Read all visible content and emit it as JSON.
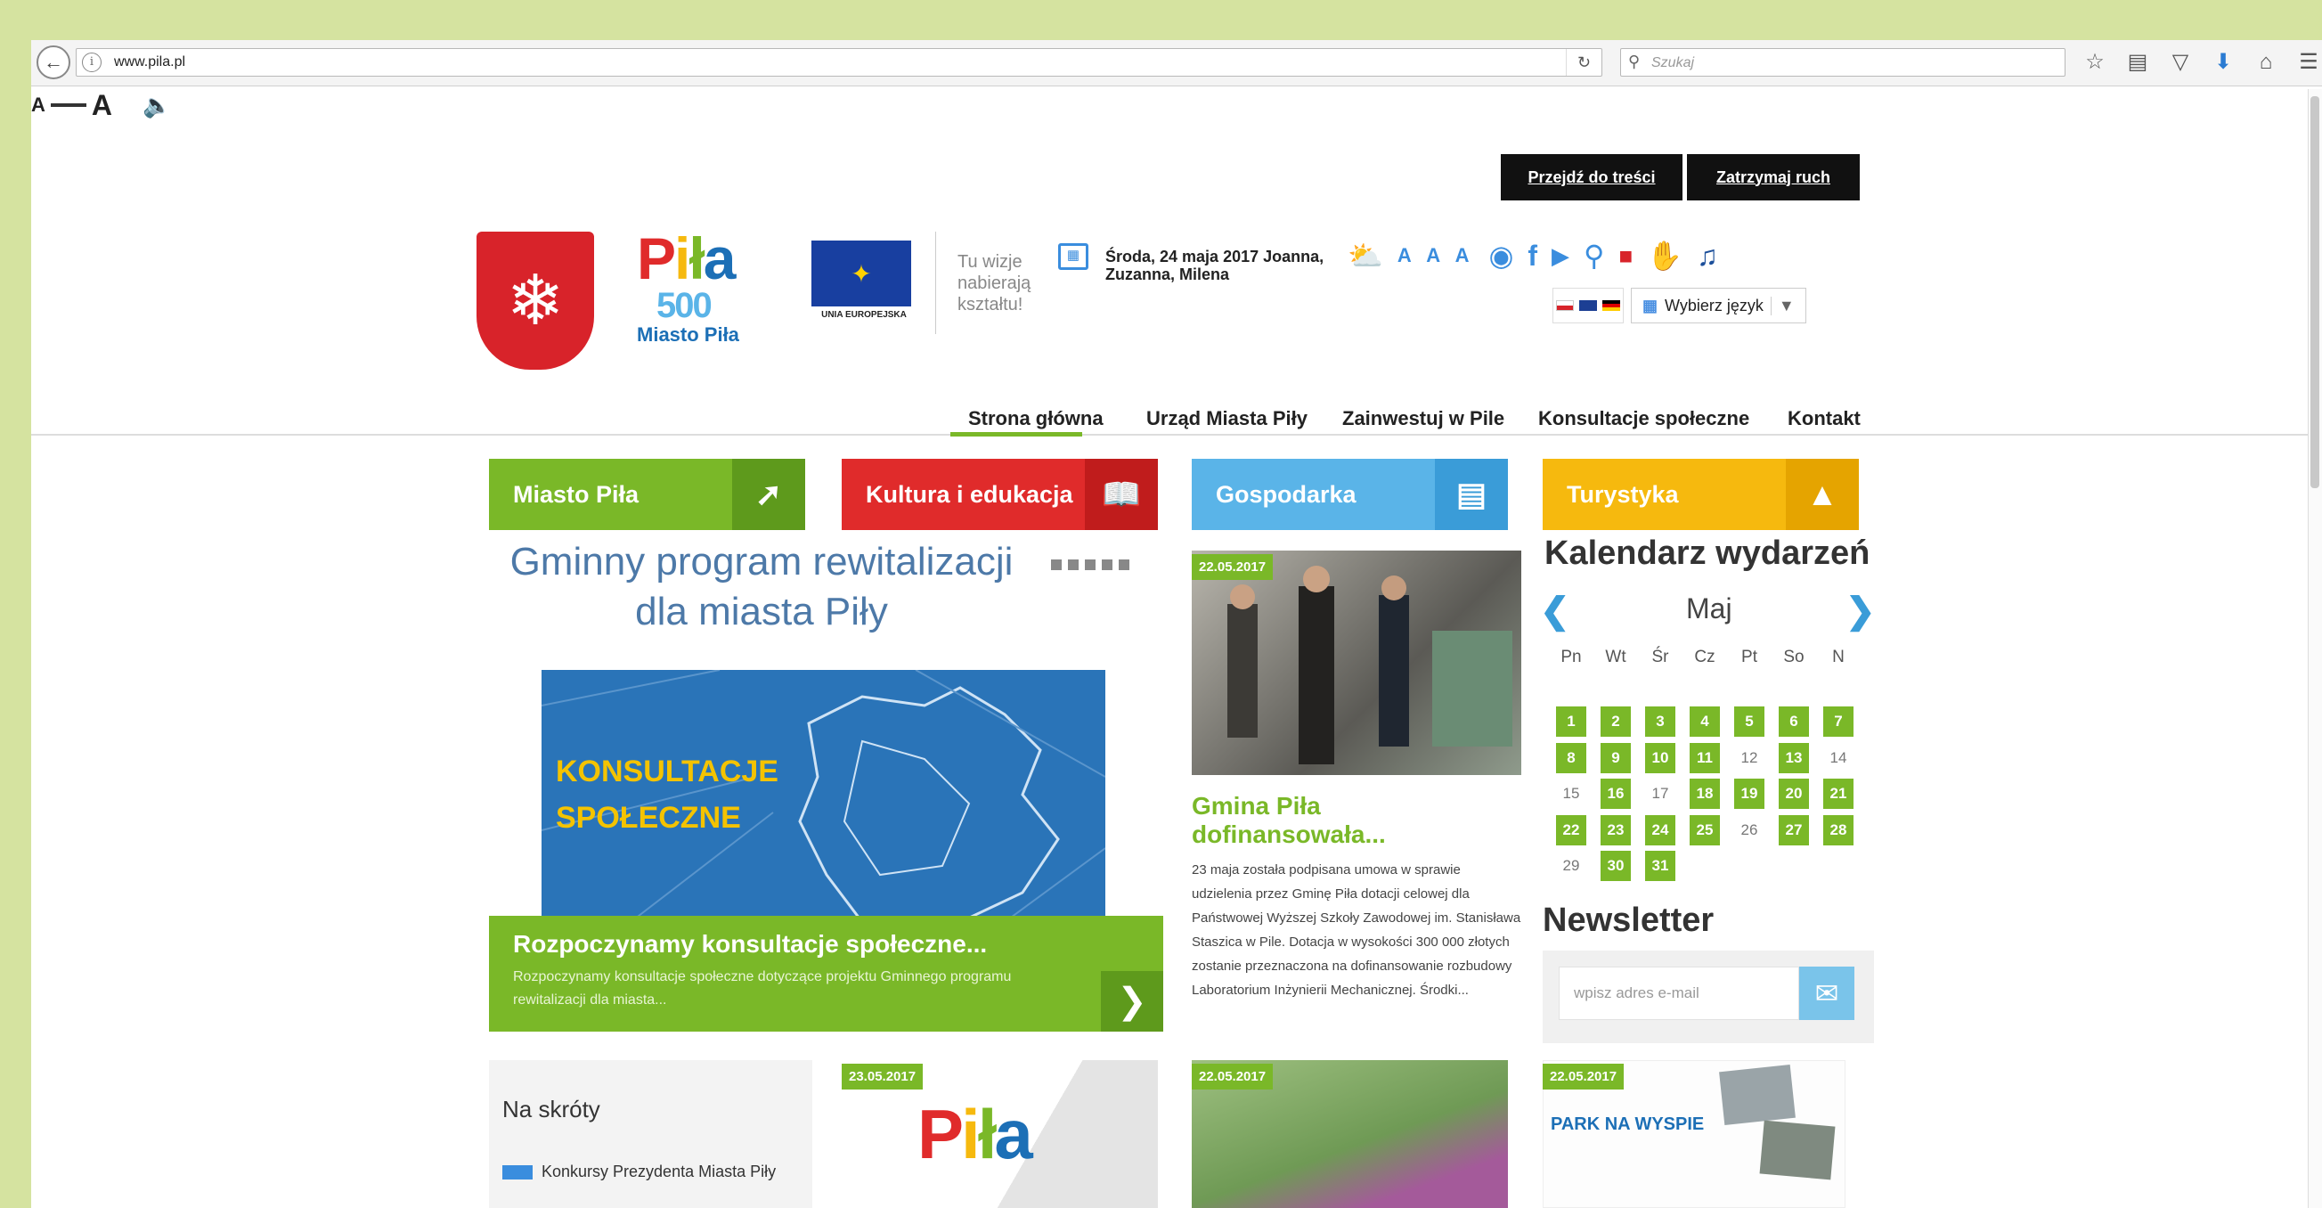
{
  "browser": {
    "url": "www.pila.pl",
    "search_placeholder": "Szukaj"
  },
  "a11y": {
    "small_a": "A",
    "big_a": "A"
  },
  "skip": {
    "content": "Przejdź do treści",
    "stop": "Zatrzymaj ruch"
  },
  "header": {
    "logo_line1": "Piła",
    "logo_line2": "500",
    "logo_line3": "Miasto Piła",
    "eu_caption": "UNIA EUROPEJSKA",
    "slogan": [
      "Tu wizje",
      "nabierają",
      "kształtu!"
    ],
    "date": "Środa, 24 maja 2017 Joanna, Zuzanna, Milena",
    "font_sizes": "A A A",
    "lang_select": "Wybierz język"
  },
  "nav": [
    "Strona główna",
    "Urząd Miasta Piły",
    "Zainwestuj w Pile",
    "Konsultacje społeczne",
    "Kontakt"
  ],
  "tiles": [
    {
      "label": "Miasto Piła",
      "color": "#7ab828",
      "dark": "#5e9a1c"
    },
    {
      "label": "Kultura i edukacja",
      "color": "#e02b2b",
      "dark": "#c01c1c"
    },
    {
      "label": "Gospodarka",
      "color": "#5ab4e8",
      "dark": "#3a9cd8"
    },
    {
      "label": "Turystyka",
      "color": "#f6b90e",
      "dark": "#e5a400"
    }
  ],
  "slider": {
    "title_line1": "Gminny program rewitalizacji",
    "title_line2": "dla miasta Piły",
    "map_text1": "KONSULTACJE",
    "map_text2": "SPOŁECZNE",
    "caption_title": "Rozpoczynamy konsultacje społeczne...",
    "caption_text": "Rozpoczynamy konsultacje społeczne dotyczące projektu Gminnego programu rewitalizacji dla miasta..."
  },
  "news": {
    "date": "22.05.2017",
    "title": "Gmina Piła dofinansowała...",
    "text": "23 maja została podpisana umowa w sprawie udzielenia przez Gminę Piła dotacji celowej dla Państwowej Wyższej Szkoły Zawodowej im. Stanisława Staszica w Pile. Dotacja w wysokości 300 000 złotych zostanie przeznaczona na dofinansowanie rozbudowy Laboratorium Inżynierii Mechanicznej. Środki..."
  },
  "calendar": {
    "title": "Kalendarz wydarzeń",
    "month": "Maj",
    "weekdays": [
      "Pn",
      "Wt",
      "Śr",
      "Cz",
      "Pt",
      "So",
      "N"
    ],
    "days": [
      "1",
      "2",
      "3",
      "4",
      "5",
      "6",
      "7",
      "8",
      "9",
      "10",
      "11",
      "12",
      "13",
      "14",
      "15",
      "16",
      "17",
      "18",
      "19",
      "20",
      "21",
      "22",
      "23",
      "24",
      "25",
      "26",
      "27",
      "28",
      "29",
      "30",
      "31"
    ],
    "no_event_days": [
      "12",
      "14",
      "15",
      "17",
      "26",
      "29"
    ]
  },
  "newsletter": {
    "title": "Newsletter",
    "placeholder": "wpisz adres e-mail"
  },
  "bottom": {
    "skroty_title": "Na skróty",
    "skroty_item": "Konkursy Prezydenta Miasta Piły",
    "date1": "23.05.2017",
    "date2": "22.05.2017",
    "date3": "22.05.2017",
    "poster_title": "PARK NA WYSPIE"
  }
}
